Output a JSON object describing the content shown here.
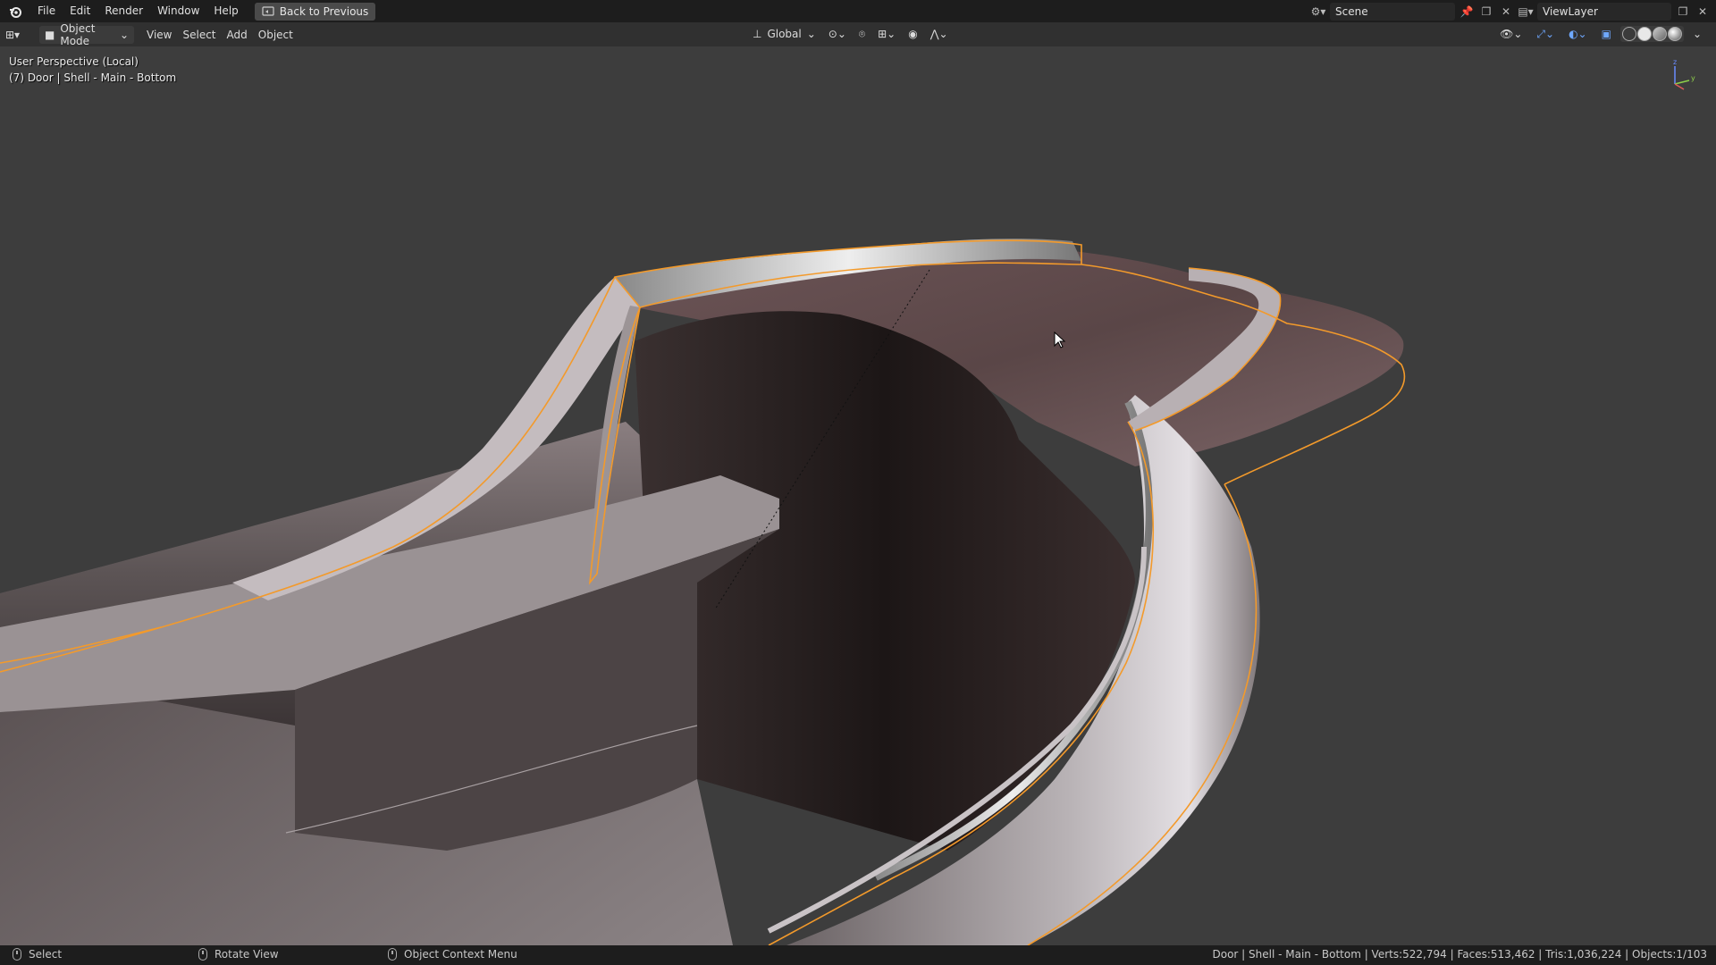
{
  "topbar": {
    "menu": [
      "File",
      "Edit",
      "Render",
      "Window",
      "Help"
    ],
    "back_button": "Back to Previous",
    "scene_name": "Scene",
    "view_layer": "ViewLayer"
  },
  "viewport_header": {
    "mode": "Object Mode",
    "menu": [
      "View",
      "Select",
      "Add",
      "Object"
    ],
    "transform_orientation": "Global"
  },
  "viewport": {
    "perspective_label": "User Perspective (Local)",
    "object_label": "(7) Door | Shell - Main - Bottom",
    "gizmo_axes": {
      "z": "z",
      "y": "y"
    },
    "selection_outline_color": "#f39a2b"
  },
  "statusbar": {
    "select": "Select",
    "rotate": "Rotate View",
    "context_menu": "Object Context Menu",
    "stats": "Door | Shell - Main - Bottom | Verts:522,794 | Faces:513,462 | Tris:1,036,224 | Objects:1/103"
  }
}
